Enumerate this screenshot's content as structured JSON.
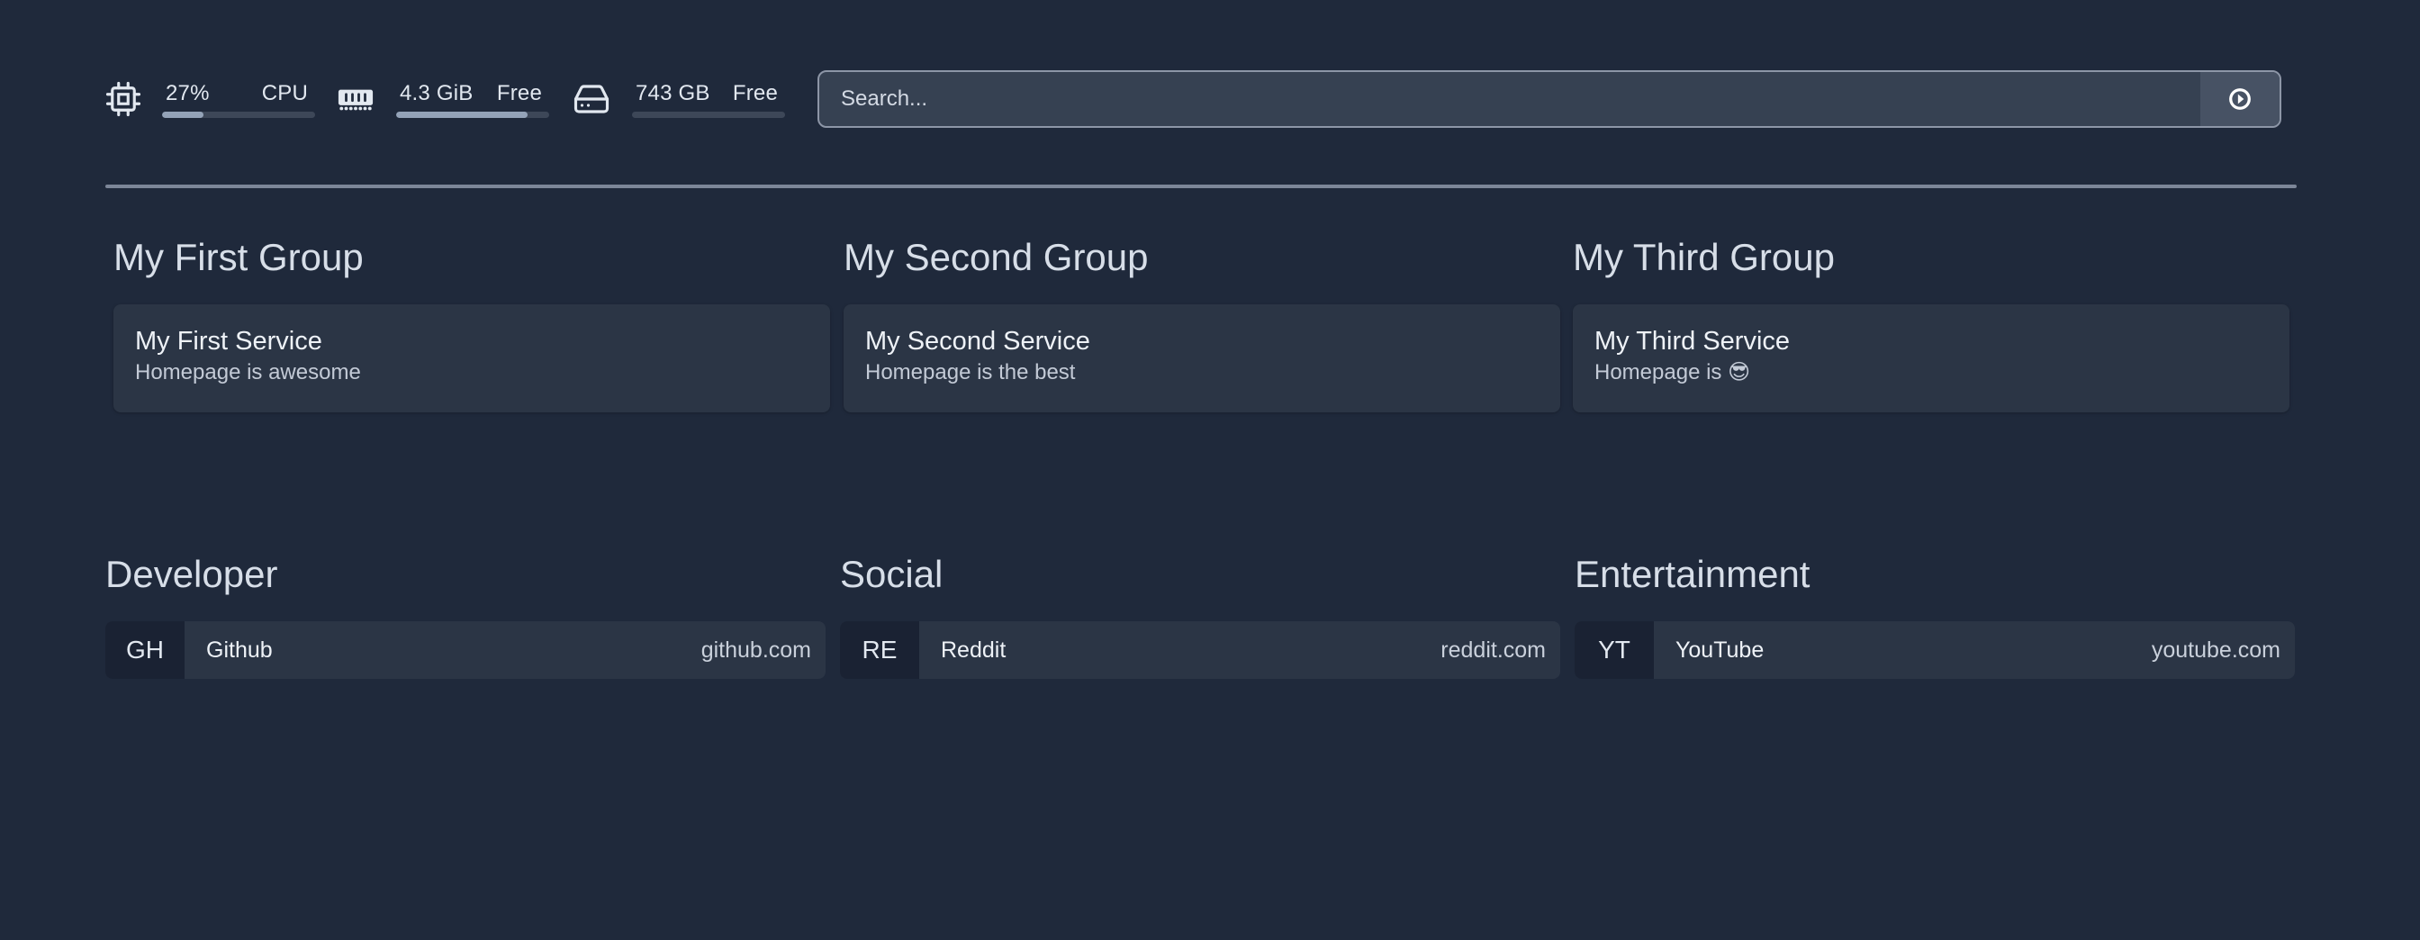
{
  "widgets": {
    "cpu": {
      "value": "27%",
      "label": "CPU",
      "usage": 0.27
    },
    "memory": {
      "value": "4.3 GiB",
      "label": "Free",
      "usage": 0.86
    },
    "disk": {
      "value": "743 GB",
      "label": "Free",
      "usage": 0.0
    }
  },
  "search": {
    "placeholder": "Search..."
  },
  "services": [
    {
      "group": "My First Group",
      "name": "My First Service",
      "description": "Homepage is awesome"
    },
    {
      "group": "My Second Group",
      "name": "My Second Service",
      "description": "Homepage is the best"
    },
    {
      "group": "My Third Group",
      "name": "My Third Service",
      "description": "Homepage is 😎"
    }
  ],
  "bookmarks": [
    {
      "group": "Developer",
      "abbr": "GH",
      "name": "Github",
      "href": "github.com"
    },
    {
      "group": "Social",
      "abbr": "RE",
      "name": "Reddit",
      "href": "reddit.com"
    },
    {
      "group": "Entertainment",
      "abbr": "YT",
      "name": "YouTube",
      "href": "youtube.com"
    }
  ],
  "icons": {
    "cpu": "cpu-icon",
    "memory": "memory-icon",
    "disk": "hard-drive-icon",
    "search_engine": "search-engine-icon"
  },
  "colors": {
    "background": "#1f293b",
    "card": "#2b3545",
    "bar_fill": "#94a3b8"
  }
}
